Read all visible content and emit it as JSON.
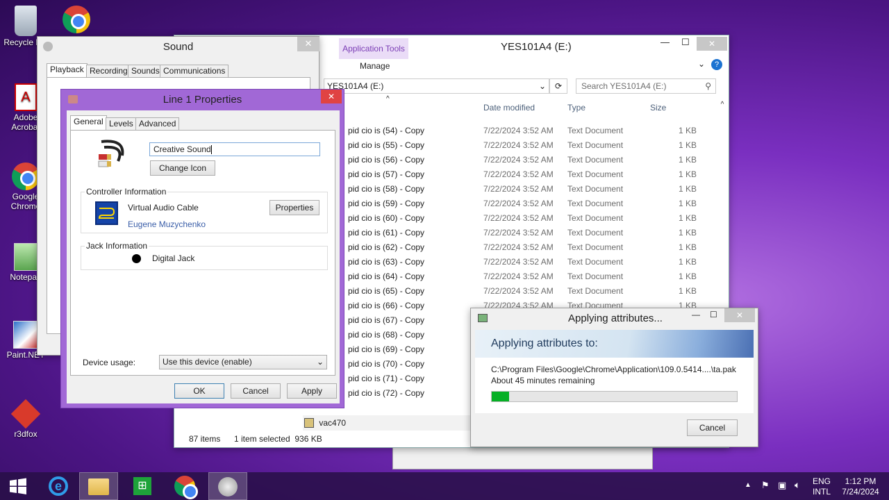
{
  "desktop": {
    "icons": [
      "Recycle Bin",
      "Adobe Acrobat",
      "Google Chrome",
      "Notepad",
      "Paint.NET",
      "r3dfox"
    ]
  },
  "explorer": {
    "title": "YES101A4 (E:)",
    "ribbon_context_tab": "Application Tools",
    "ribbon_manage": "Manage",
    "address": "YES101A4 (E:)",
    "search_placeholder": "Search YES101A4 (E:)",
    "columns": [
      "Date modified",
      "Type",
      "Size"
    ],
    "rows": [
      {
        "name": "pid cio is (54) - Copy",
        "date": "7/22/2024 3:52 AM",
        "type": "Text Document",
        "size": "1 KB"
      },
      {
        "name": "pid cio is (55) - Copy",
        "date": "7/22/2024 3:52 AM",
        "type": "Text Document",
        "size": "1 KB"
      },
      {
        "name": "pid cio is (56) - Copy",
        "date": "7/22/2024 3:52 AM",
        "type": "Text Document",
        "size": "1 KB"
      },
      {
        "name": "pid cio is (57) - Copy",
        "date": "7/22/2024 3:52 AM",
        "type": "Text Document",
        "size": "1 KB"
      },
      {
        "name": "pid cio is (58) - Copy",
        "date": "7/22/2024 3:52 AM",
        "type": "Text Document",
        "size": "1 KB"
      },
      {
        "name": "pid cio is (59) - Copy",
        "date": "7/22/2024 3:52 AM",
        "type": "Text Document",
        "size": "1 KB"
      },
      {
        "name": "pid cio is (60) - Copy",
        "date": "7/22/2024 3:52 AM",
        "type": "Text Document",
        "size": "1 KB"
      },
      {
        "name": "pid cio is (61) - Copy",
        "date": "7/22/2024 3:52 AM",
        "type": "Text Document",
        "size": "1 KB"
      },
      {
        "name": "pid cio is (62) - Copy",
        "date": "7/22/2024 3:52 AM",
        "type": "Text Document",
        "size": "1 KB"
      },
      {
        "name": "pid cio is (63) - Copy",
        "date": "7/22/2024 3:52 AM",
        "type": "Text Document",
        "size": "1 KB"
      },
      {
        "name": "pid cio is (64) - Copy",
        "date": "7/22/2024 3:52 AM",
        "type": "Text Document",
        "size": "1 KB"
      },
      {
        "name": "pid cio is (65) - Copy",
        "date": "7/22/2024 3:52 AM",
        "type": "Text Document",
        "size": "1 KB"
      },
      {
        "name": "pid cio is (66) - Copy",
        "date": "7/22/2024 3:52 AM",
        "type": "Text Document",
        "size": "1 KB"
      },
      {
        "name": "pid cio is (67) - Copy",
        "date": "",
        "type": "",
        "size": ""
      },
      {
        "name": "pid cio is (68) - Copy",
        "date": "",
        "type": "",
        "size": ""
      },
      {
        "name": "pid cio is (69) - Copy",
        "date": "",
        "type": "",
        "size": ""
      },
      {
        "name": "pid cio is (70) - Copy",
        "date": "",
        "type": "",
        "size": ""
      },
      {
        "name": "pid cio is (71) - Copy",
        "date": "",
        "type": "",
        "size": ""
      },
      {
        "name": "pid cio is (72) - Copy",
        "date": "",
        "type": "",
        "size": ""
      }
    ],
    "last_row": "vac470",
    "status_items": "87 items",
    "status_selected": "1 item selected  936 KB"
  },
  "sound": {
    "title": "Sound",
    "tabs": [
      "Playback",
      "Recording",
      "Sounds",
      "Communications"
    ]
  },
  "props": {
    "title": "Line 1 Properties",
    "tabs": [
      "General",
      "Levels",
      "Advanced"
    ],
    "name_value": "Creative Sound",
    "change_icon": "Change Icon",
    "controller_label": "Controller Information",
    "controller_name": "Virtual Audio Cable",
    "controller_vendor": "Eugene Muzychenko",
    "properties_btn": "Properties",
    "jack_label": "Jack Information",
    "jack_name": "Digital Jack",
    "device_usage_label": "Device usage:",
    "device_usage_value": "Use this device (enable)",
    "ok": "OK",
    "cancel": "Cancel",
    "apply": "Apply"
  },
  "apply_dialog": {
    "title": "Applying attributes...",
    "header": "Applying attributes to:",
    "path": "C:\\Program Files\\Google\\Chrome\\Application\\109.0.5414....\\ta.pak",
    "remaining": "About 45 minutes remaining",
    "progress": 0.07,
    "cancel": "Cancel"
  },
  "taskbar": {
    "lang": "ENG",
    "layout": "INTL",
    "time": "1:12 PM",
    "date": "7/24/2024"
  }
}
